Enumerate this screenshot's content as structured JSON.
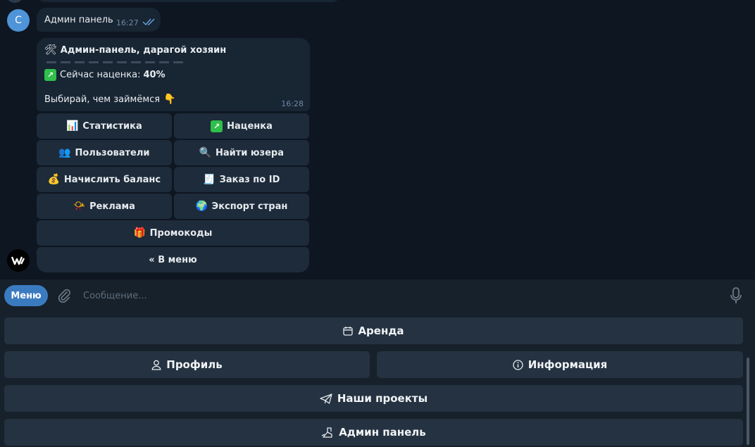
{
  "chat": {
    "user_avatar_letter": "С",
    "out_message": {
      "text": "Админ панель",
      "time": "16:27"
    },
    "bot_message": {
      "title_emoji": "🛠",
      "title": "Админ-панель, дарагой хозяин",
      "markup_prefix": "Сейчас наценка:",
      "markup_value": "40%",
      "prompt": "Выбирай, чем займёмся",
      "prompt_emoji": "👇",
      "time": "16:28"
    },
    "inline_keyboard": {
      "stats": {
        "icon": "📊",
        "label": "Статистика"
      },
      "markup": {
        "icon": "💹",
        "label": "Наценка"
      },
      "users": {
        "icon": "👥",
        "label": "Пользователи"
      },
      "find_user": {
        "icon": "🔍",
        "label": "Найти юзера"
      },
      "add_balance": {
        "icon": "💰",
        "label": "Начислить баланс"
      },
      "order_by_id": {
        "icon": "🧾",
        "label": "Заказ по ID"
      },
      "ads": {
        "icon": "📯",
        "label": "Реклама"
      },
      "export_countries": {
        "icon": "🌍",
        "label": "Экспорт стран"
      },
      "promo": {
        "icon": "🎁",
        "label": "Промокоды"
      },
      "back": {
        "label": "« В меню"
      }
    }
  },
  "composer": {
    "menu_label": "Меню",
    "placeholder": "Сообщение..."
  },
  "reply_keyboard": {
    "rent": {
      "icon": "calendar-icon",
      "label": "Аренда"
    },
    "profile": {
      "icon": "person-icon",
      "label": "Профиль"
    },
    "info": {
      "icon": "info-icon",
      "label": "Информация"
    },
    "projects": {
      "icon": "telegram-plane-icon",
      "label": "Наши проекты"
    },
    "admin": {
      "icon": "admin-icon",
      "label": "Админ панель"
    }
  },
  "colors": {
    "background": "#0e1621",
    "bubble": "#182533",
    "accent": "#3a7bc0",
    "keyboard_button": "#253241"
  }
}
